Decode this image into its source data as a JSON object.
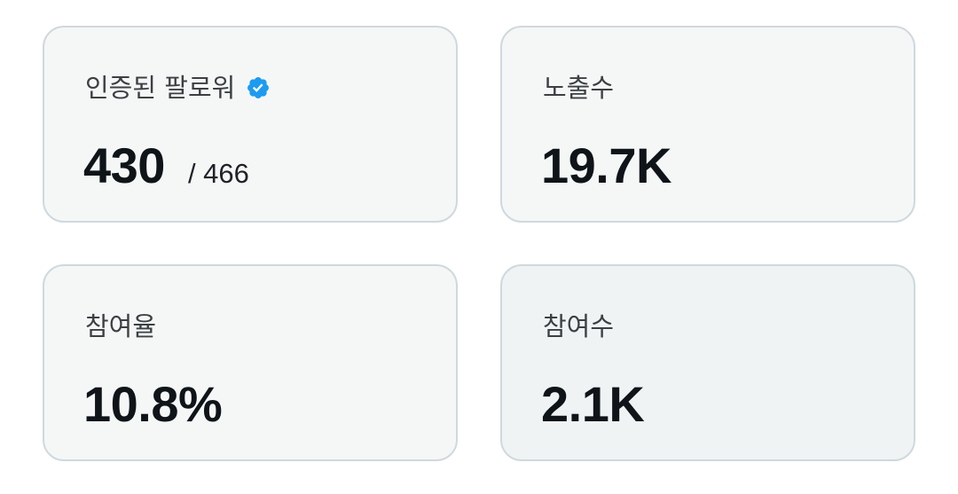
{
  "colors": {
    "verified_badge": "#1d9bf0",
    "card_border": "#cfd9de",
    "card_background": "#f5f7f7",
    "card_background_hovered": "#eff3f4",
    "text_primary": "#0f1419"
  },
  "cards": [
    {
      "label": "인증된 팔로워",
      "icon": "verified-badge-icon",
      "value": "430",
      "sub": "/ 466"
    },
    {
      "label": "노출수",
      "value": "19.7K"
    },
    {
      "label": "참여율",
      "value": "10.8%"
    },
    {
      "label": "참여수",
      "value": "2.1K"
    }
  ]
}
